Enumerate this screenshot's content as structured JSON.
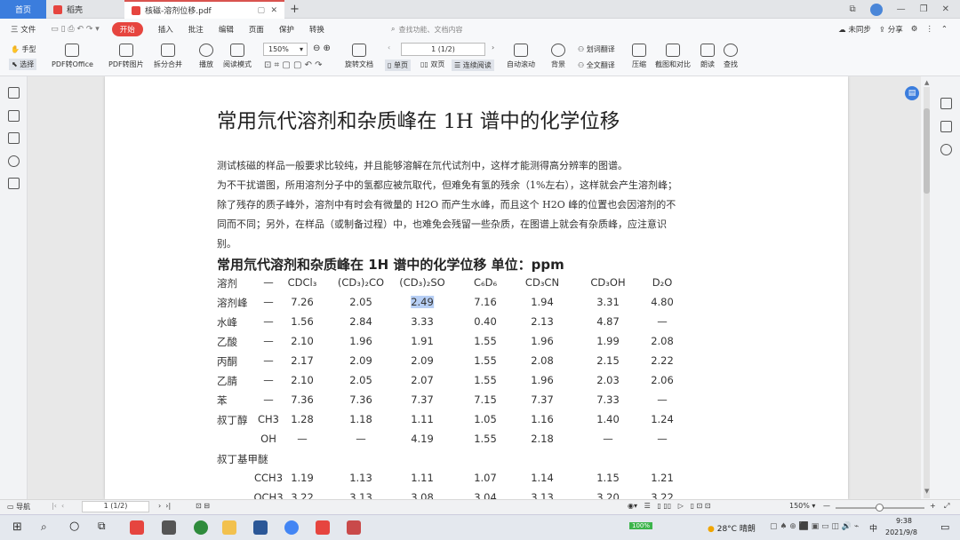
{
  "tabs": {
    "home": "首页",
    "daoke": "稻壳",
    "doc": "核磁-溶剂位移.pdf",
    "new_tab": "+"
  },
  "window_icons": {
    "layout": "⧉",
    "minimize": "—",
    "restore": "❐",
    "close": "✕"
  },
  "menu": {
    "file": "三 文件",
    "items": [
      "开始",
      "插入",
      "批注",
      "编辑",
      "页面",
      "保护",
      "转换"
    ],
    "active": "开始",
    "search_placeholder": "查找功能、文档内容",
    "sync": "未同步",
    "share": "分享"
  },
  "toolbar": {
    "hand": "手型",
    "select": "选择",
    "pdf_to_office": "PDF转Office",
    "pdf_to_image": "PDF转图片",
    "split_merge": "拆分合并",
    "play": "播放",
    "read_mode": "阅读模式",
    "zoom": "150%",
    "rotate": "旋转文档",
    "single_page": "单页",
    "double_page": "双页",
    "continuous": "连续阅读",
    "page_indicator": "1 (1/2)",
    "auto_scroll": "自动滚动",
    "background": "背景",
    "word_translate": "划词翻译",
    "full_translate": "全文翻译",
    "compress": "压缩",
    "screenshot_compare": "截图和对比",
    "read_aloud": "朗读",
    "find": "查找"
  },
  "document": {
    "title": "常用氘代溶剂和杂质峰在 1H 谱中的化学位移",
    "paragraphs": [
      "测试核磁的样品一般要求比较纯，并且能够溶解在氘代试剂中，这样才能测得高分辨率的图谱。",
      "为不干扰谱图，所用溶剂分子中的氢都应被氘取代，但难免有氢的残余（1%左右），这样就会产生溶剂峰；",
      "除了残存的质子峰外，溶剂中有时会有微量的 H2O 而产生水峰，而且这个 H2O 峰的位置也会因溶剂的不",
      "同而不同；另外，在样品（或制备过程）中，也难免会残留一些杂质，在图谱上就会有杂质峰，应注意识",
      "别。"
    ],
    "table_title": "常用氘代溶剂和杂质峰在 1H 谱中的化学位移    单位：ppm",
    "table_header": [
      "溶剂",
      "—",
      "CDCl₃",
      "(CD₃)₂CO",
      "(CD₃)₂SO",
      "C₆D₆",
      "CD₃CN",
      "CD₃OH",
      "D₂O"
    ],
    "table_rows": [
      [
        "溶剂峰",
        "—",
        "7.26",
        "2.05",
        "2.49",
        "7.16",
        "1.94",
        "3.31",
        "4.80"
      ],
      [
        "水峰",
        "—",
        "1.56",
        "2.84",
        "3.33",
        "0.40",
        "2.13",
        "4.87",
        "—"
      ],
      [
        "乙酸",
        "—",
        "2.10",
        "1.96",
        "1.91",
        "1.55",
        "1.96",
        "1.99",
        "2.08"
      ],
      [
        "丙酮",
        "—",
        "2.17",
        "2.09",
        "2.09",
        "1.55",
        "2.08",
        "2.15",
        "2.22"
      ],
      [
        "乙腈",
        "—",
        "2.10",
        "2.05",
        "2.07",
        "1.55",
        "1.96",
        "2.03",
        "2.06"
      ],
      [
        "苯",
        "—",
        "7.36",
        "7.36",
        "7.37",
        "7.15",
        "7.37",
        "7.33",
        "—"
      ],
      [
        "叔丁醇",
        "CH3",
        "1.28",
        "1.18",
        "1.11",
        "1.05",
        "1.16",
        "1.40",
        "1.24"
      ],
      [
        "",
        "OH",
        "—",
        "—",
        "4.19",
        "1.55",
        "2.18",
        "—",
        "—"
      ],
      [
        "叔丁基甲醚",
        "",
        "",
        "",
        "",
        "",
        "",
        "",
        ""
      ],
      [
        "",
        "CCH3",
        "1.19",
        "1.13",
        "1.11",
        "1.07",
        "1.14",
        "1.15",
        "1.21"
      ],
      [
        "",
        "OCH3",
        "3.22",
        "3.13",
        "3.08",
        "3.04",
        "3.13",
        "3.20",
        "3.22"
      ]
    ],
    "selected_value": "2.49"
  },
  "status": {
    "nav": "导航",
    "page": "1 (1/2)",
    "zoom": "150%",
    "minus": "—",
    "plus": "+"
  },
  "taskbar": {
    "weather": "28°C 晴朗",
    "ime": "中",
    "time": "9:38",
    "date": "2021/9/8",
    "battery": "100%"
  },
  "colors": {
    "accent_red": "#e6453f",
    "tab_blue": "#3b7ddd",
    "selection": "#b7cff5"
  }
}
